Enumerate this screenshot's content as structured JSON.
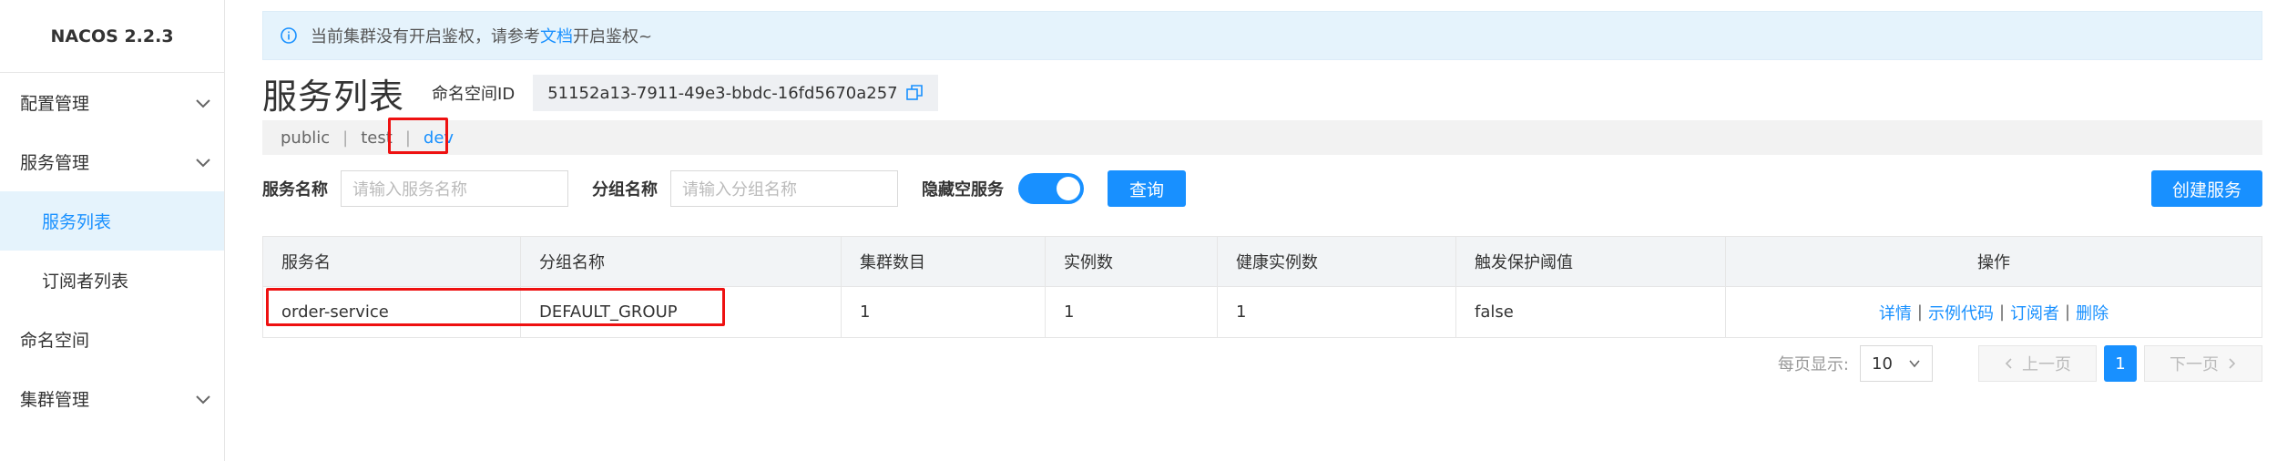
{
  "app": {
    "title": "NACOS 2.2.3"
  },
  "sidebar": {
    "items": [
      {
        "label": "配置管理",
        "icon": "chevron-down-icon"
      },
      {
        "label": "服务管理",
        "icon": "chevron-down-icon"
      },
      {
        "label": "服务列表"
      },
      {
        "label": "订阅者列表"
      },
      {
        "label": "命名空间"
      },
      {
        "label": "集群管理",
        "icon": "chevron-down-icon"
      }
    ]
  },
  "notice": {
    "text_before": "当前集群没有开启鉴权，请参考",
    "link": "文档",
    "text_after": "开启鉴权~"
  },
  "page": {
    "title": "服务列表",
    "namespace_label": "命名空间ID",
    "namespace_id": "51152a13-7911-49e3-bbdc-16fd5670a257"
  },
  "namespaces": [
    "public",
    "test",
    "dev"
  ],
  "filter": {
    "service_name_label": "服务名称",
    "service_name_placeholder": "请输入服务名称",
    "group_name_label": "分组名称",
    "group_name_placeholder": "请输入分组名称",
    "hide_empty_label": "隐藏空服务",
    "hide_empty_on": true,
    "query_label": "查询",
    "create_label": "创建服务"
  },
  "table": {
    "headers": [
      "服务名",
      "分组名称",
      "集群数目",
      "实例数",
      "健康实例数",
      "触发保护阈值",
      "操作"
    ],
    "rows": [
      {
        "service": "order-service",
        "group": "DEFAULT_GROUP",
        "clusters": "1",
        "instances": "1",
        "healthy": "1",
        "threshold": "false",
        "ops": [
          "详情",
          "示例代码",
          "订阅者",
          "删除"
        ]
      }
    ]
  },
  "pager": {
    "per_page_label": "每页显示:",
    "per_page": "10",
    "prev": "上一页",
    "current": "1",
    "next": "下一页"
  },
  "colors": {
    "accent": "#1890ff",
    "highlight": "#e11111"
  }
}
